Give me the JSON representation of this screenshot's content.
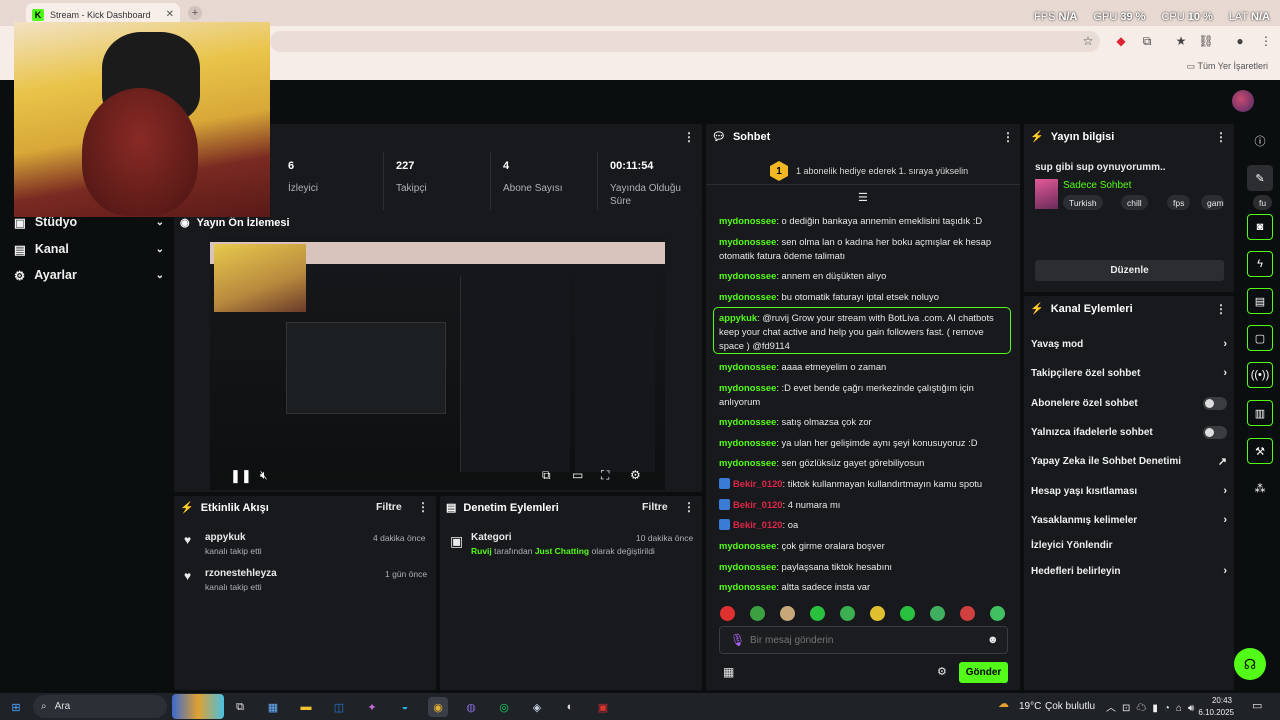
{
  "browser": {
    "tab_title": "Stream - Kick Dashboard",
    "bookmarks_label": "Tüm Yer İşaretleri"
  },
  "perf": {
    "fps_label": "FPS",
    "fps_value": "N/A",
    "gpu_label": "GPU",
    "gpu_value": "39 %",
    "cpu_label": "CPU",
    "cpu_value": "10 %",
    "lat_label": "LAT",
    "lat_value": "N/A"
  },
  "sidebar": {
    "items": [
      {
        "label": "Stüdyo",
        "icon": "studio-icon"
      },
      {
        "label": "Kanal",
        "icon": "channel-icon"
      },
      {
        "label": "Ayarlar",
        "icon": "gear-icon"
      }
    ]
  },
  "stats": [
    {
      "value": "6",
      "label": "İzleyici"
    },
    {
      "value": "227",
      "label": "Takipçi"
    },
    {
      "value": "4",
      "label": "Abone Sayısı"
    },
    {
      "value": "00:11:54",
      "label": "Yayında Olduğu Süre"
    }
  ],
  "preview": {
    "title": "Yayın Ön İzlemesi"
  },
  "activity": {
    "title": "Etkinlik Akışı",
    "filter": "Filtre",
    "items": [
      {
        "user": "appykuk",
        "text": "kanalı takip etti",
        "time": "4 dakika önce"
      },
      {
        "user": "rzonestehleyza",
        "text": "kanalı takip etti",
        "time": "1 gün önce"
      }
    ]
  },
  "moderation": {
    "title": "Denetim Eylemleri",
    "filter": "Filtre",
    "item": {
      "title": "Kategori",
      "time": "10 dakika önce",
      "user": "Ruvij",
      "mid": "tarafından",
      "category": "Just Chatting",
      "tail": "olarak değiştirildi"
    }
  },
  "chat": {
    "title": "Sohbet",
    "gift_badge": "1",
    "gift_text": "1 abonelik hediye ederek 1. sıraya yükselin",
    "messages": [
      {
        "user": "mydonossee",
        "text": "o dediğin bankaya annemin emeklisini taşıdık :D",
        "kind": "u"
      },
      {
        "user": "mydonossee",
        "text": "sen olma lan o kadına her boku açmışlar ek hesap otomatik fatura ödeme talimatı",
        "kind": "u"
      },
      {
        "user": "mydonossee",
        "text": "annem en düşükten alıyo",
        "kind": "u"
      },
      {
        "user": "mydonossee",
        "text": "bu otomatik faturayı iptal etsek noluyo",
        "kind": "u"
      },
      {
        "user": "appykuk",
        "text": "@ruvij Grow your stream with BotLiva .com. AI chatbots keep your chat active and help you gain followers fast. ( remove space ) @fd9114",
        "kind": "u"
      },
      {
        "user": "mydonossee",
        "text": "aaaa etmeyelim o zaman",
        "kind": "u"
      },
      {
        "user": "mydonossee",
        "text": ":D evet bende çağrı merkezinde çalıştığım için anlıyorum",
        "kind": "u"
      },
      {
        "user": "mydonossee",
        "text": "satış olmazsa çok zor",
        "kind": "u"
      },
      {
        "user": "mydonossee",
        "text": "ya ulan her gelişimde aynı şeyi konusuyoruz :D",
        "kind": "u"
      },
      {
        "user": "mydonossee",
        "text": "sen gözlüksüz gayet görebiliyosun",
        "kind": "u"
      },
      {
        "user": "Bekir_0120",
        "text": "tiktok kullanmayan kullandırtmayın kamu spotu",
        "kind": "r"
      },
      {
        "user": "Bekir_0120",
        "text": "4 numara mı",
        "kind": "r"
      },
      {
        "user": "Bekir_0120",
        "text": "oa",
        "kind": "r"
      },
      {
        "user": "mydonossee",
        "text": "çok girme oralara boşver",
        "kind": "u"
      },
      {
        "user": "mydonossee",
        "text": "paylaşsana tiktok hesabını",
        "kind": "u"
      },
      {
        "user": "mydonossee",
        "text": "altta sadece insta var",
        "kind": "u"
      }
    ],
    "input_placeholder": "Bir mesaj gönderin",
    "send": "Gönder"
  },
  "stream_info": {
    "title": "Yayın bilgisi",
    "stream_title": "sup gibi sup oynuyorumm..",
    "category": "Sadece Sohbet",
    "tags": [
      "Turkish",
      "chill",
      "fps",
      "gaming",
      "fu"
    ],
    "edit": "Düzenle"
  },
  "channel_actions": {
    "title": "Kanal Eylemleri",
    "rows": [
      {
        "label": "Yavaş mod",
        "type": "chevron"
      },
      {
        "label": "Takipçilere özel sohbet",
        "type": "chevron"
      },
      {
        "label": "Abonelere özel sohbet",
        "type": "toggle"
      },
      {
        "label": "Yalnızca ifadelerle sohbet",
        "type": "toggle"
      },
      {
        "label": "Yapay Zeka ile Sohbet Denetimi",
        "type": "external"
      },
      {
        "label": "Hesap yaşı kısıtlaması",
        "type": "chevron"
      },
      {
        "label": "Yasaklanmış kelimeler",
        "type": "chevron"
      },
      {
        "label": "İzleyici Yönlendir",
        "type": "none"
      },
      {
        "label": "Hedefleri belirleyin",
        "type": "chevron"
      }
    ]
  },
  "taskbar": {
    "search": "Ara",
    "weather_temp": "19°C",
    "weather_text": "Çok bulutlu",
    "time": "20:43",
    "date": "6.10.2025"
  },
  "colors": {
    "accent": "#53fc18",
    "panel": "#18191c",
    "bg": "#0b0e0f",
    "mention": "#e0264a"
  }
}
